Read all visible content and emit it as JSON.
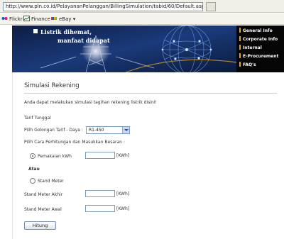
{
  "browser": {
    "url": "http://www.pln.co.id/PelayananPelanggan/BillingSimulation/tabid/60/Default.aspx",
    "links": [
      {
        "label": "Flickr",
        "icon": "flickr-icon"
      },
      {
        "label": "Finance",
        "icon": "finance-icon"
      },
      {
        "label": "eBay",
        "icon": "ebay-icon"
      }
    ]
  },
  "banner": {
    "slogan_line1": "Listrik dihemat,",
    "slogan_line2": "manfaat didapat",
    "nav": [
      "General Info",
      "Corporate Info",
      "Internal",
      "E-Procurement",
      "FAQ's"
    ]
  },
  "form": {
    "title": "Simulasi Rekening",
    "intro": "Anda dapat melakukan simulasi tagihan rekening listrik disini!",
    "tarif_label": "Tarif Tunggal",
    "golongan_label": "Pilih Golongan Tarif - Daya :",
    "golongan_value": "R1-450",
    "cara_label": "Pilih Cara Perhitungan dan Masukkan Besaran :",
    "pemakaian_label": "Pemakaian kWh",
    "unit": "[KWh]",
    "atau": "Atau",
    "stand_meter_label": "Stand Meter",
    "akhir_label": "Stand Meter Akhir",
    "awal_label": "Stand Meter Awal",
    "button": "Hitung"
  },
  "colors": {
    "nav_bg": "#050505",
    "banner_bg": "#0a1530",
    "accent": "#e0a020"
  }
}
